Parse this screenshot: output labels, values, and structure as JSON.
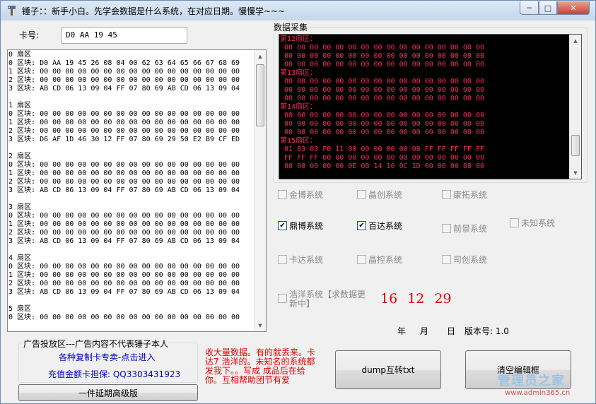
{
  "window": {
    "title": "锤子：：新手小白。先学会数据是什么系统，在对应日期。慢慢学~~~",
    "min_glyph": "─",
    "max_glyph": "□",
    "close_glyph": "✕"
  },
  "card": {
    "label": "卡号:",
    "value": "D0 AA 19 45"
  },
  "dump": {
    "text": "0 扇区\n0 区块: D0 AA 19 45 26 08 04 00 62 63 64 65 66 67 68 69\n1 区块: 00 00 00 00 00 00 00 00 00 00 00 00 00 00 00 00\n2 区块: 00 00 00 00 00 00 00 00 00 00 00 00 00 00 00 00\n3 区块: AB CD 06 13 09 04 FF 07 80 69 AB CD 06 13 09 04\n\n1 扇区\n0 区块: 00 00 00 00 00 00 00 00 00 00 00 00 00 00 00 00\n1 区块: 00 00 00 00 00 00 00 00 00 00 00 00 00 00 00 00\n2 区块: 00 00 00 00 00 00 00 00 00 00 00 00 00 00 00 00\n3 区块: D6 AF 1D 46 30 12 FF 07 80 69 29 50 E2 B9 CF ED\n\n2 扇区\n0 区块: 00 00 00 00 00 00 00 00 00 00 00 00 00 00 00 00\n1 区块: 00 00 00 00 00 00 00 00 00 00 00 00 00 00 00 00\n2 区块: 00 00 00 00 00 00 00 00 00 00 00 00 00 00 00 00\n3 区块: AB CD 06 13 09 04 FF 07 80 69 AB CD 06 13 09 04\n\n3 扇区\n0 区块: 00 00 00 00 00 00 00 00 00 00 00 00 00 00 00 00\n1 区块: 00 00 00 00 00 00 00 00 00 00 00 00 00 00 00 00\n2 区块: 00 00 00 00 00 00 00 00 00 00 00 00 00 00 00 00\n3 区块: AB CD 06 13 09 04 FF 07 80 69 AB CD 06 13 09 04\n\n4 扇区\n0 区块: 00 00 00 00 00 00 00 00 00 00 00 00 00 00 00 00\n1 区块: 00 00 00 00 00 00 00 00 00 00 00 00 00 00 00 00\n2 区块: 00 00 00 00 00 00 00 00 00 00 00 00 00 00 00 00\n3 区块: AB CD 06 13 09 04 FF 07 80 69 AB CD 06 13 09 04\n\n5 扇区\n0 区块: 00 00 00 00 00 00 00 00 00 00 00 00 00 00 00 00"
  },
  "collect": {
    "title": "数据采集",
    "text": "第12扇区：\n 00 00 00 00 00 00 00 00 00 00 00 00 00 00 00 00\n 00 00 00 00 00 00 00 00 00 00 00 00 00 00 00 00\n 00 00 00 00 00 00 00 00 00 00 00 00 00 00 00 00\n第13扇区：\n 00 00 00 00 00 00 00 00 00 00 00 00 00 00 00 00\n 00 00 00 00 00 00 00 00 00 00 00 00 00 00 00 00\n 00 00 00 00 00 00 00 00 00 00 00 00 00 00 00 00\n第14扇区：\n 00 00 00 00 00 00 00 00 00 00 00 00 00 00 00 00\n 00 00 00 00 00 00 00 00 00 00 00 00 00 00 00 00\n 00 00 00 00 00 00 00 00 00 00 00 00 00 00 00 00\n第15扇区：\n 01 B3 03 F0 11 00 00 00 00 00 08 FF FF FF FF FF\n FF FF FF 00 00 00 00 00 00 00 00 00 00 00 00 00\n 00 00 00 00 00 0E 0B 14 10 0C 1D 00 00 00 88 00",
    "text_color": "#f02e5a"
  },
  "systems": {
    "jinbo": {
      "label": "金博系统",
      "checked": false
    },
    "jingchuang": {
      "label": "晶创系统",
      "checked": false
    },
    "kangtuo": {
      "label": "康拓系统",
      "checked": false
    },
    "dingbo": {
      "label": "鼎博系统",
      "checked": true
    },
    "baida": {
      "label": "百达系统",
      "checked": true
    },
    "qianjing": {
      "label": "前景系统",
      "checked": false
    },
    "weizhi": {
      "label": "未知系统",
      "checked": false
    },
    "kada": {
      "label": "卡达系统",
      "checked": false
    },
    "jingkong": {
      "label": "晶控系统",
      "checked": false
    },
    "sichuang": {
      "label": "司创系统",
      "checked": false
    },
    "haoyang": {
      "label": "浩洋系统【求数据更新中】",
      "checked": false
    }
  },
  "date": {
    "year": "16",
    "month": "12",
    "day": "29",
    "year_label": "年",
    "month_label": "月",
    "day_label": "日",
    "version_label": "版本号: 1.0"
  },
  "ad": {
    "title": "广告投放区---广告内容不代表锤子本人",
    "link1": "各种复制卡专卖-点击进入",
    "link2": "充值金额卡担保: QQ3303431923",
    "button": "一件延期高级版"
  },
  "note": "收大量数据。有的就丢来。卡达7    浩洋的。未知名的系统都发我下。。写成 成品后在给你。互相帮助团节有爱",
  "buttons": {
    "dump": "dump互转txt",
    "clear": "清空编辑框"
  },
  "watermark": {
    "name": "管理员之家",
    "url": "www.admin365.cn"
  },
  "colors": {
    "accent_red": "#e60000",
    "link_blue": "#0000cc",
    "console_bg": "#000000"
  }
}
